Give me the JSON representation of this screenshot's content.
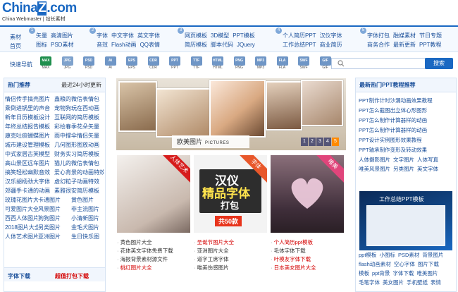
{
  "site": {
    "brand": "China",
    "brand_z": "Z",
    "brand_com": ".com",
    "sub_en": "China Webmaster",
    "sub_cn": "站长素材"
  },
  "nav": {
    "home_a": "素材",
    "home_b": "首页",
    "groups": [
      {
        "num": "1",
        "r1": [
          "矢量",
          "高清图片"
        ],
        "r2": [
          "图标",
          "PSD素材"
        ]
      },
      {
        "num": "2",
        "r1": [
          "字体",
          "中文字体",
          "英文字体"
        ],
        "r2": [
          "音效",
          "Flash动画",
          "QQ表情"
        ]
      },
      {
        "num": "3",
        "r1": [
          "网页模板",
          "3D模型",
          "PPT模板"
        ],
        "r2": [
          "简历模板",
          "脚本代码",
          "JQuery"
        ]
      },
      {
        "num": "4",
        "r1": [
          "个人简历PPT",
          "汉仪字体"
        ],
        "r2": [
          "工作总结PPT",
          "商业简历"
        ]
      },
      {
        "num": "5",
        "r1": [
          "字体打包",
          "融媒素材",
          "节日专题"
        ],
        "r2": [
          "商务合作",
          "最新更新",
          "PPT教程"
        ]
      }
    ]
  },
  "quick": {
    "label": "快速导航",
    "items": [
      {
        "name": "MAX",
        "color": "#1f8f4d"
      },
      {
        "name": "JPG",
        "color": "#7fa2cc"
      },
      {
        "name": "PSD",
        "color": "#6f96c6"
      },
      {
        "name": "Ai",
        "color": "#6f96c6"
      },
      {
        "name": "EPS",
        "color": "#6f96c6"
      },
      {
        "name": "CDR",
        "color": "#6f96c6"
      },
      {
        "name": "PPT",
        "color": "#6f96c6"
      },
      {
        "name": "TTF",
        "color": "#6f96c6"
      },
      {
        "name": "HTML",
        "color": "#6f96c6"
      },
      {
        "name": "PNG",
        "color": "#6f96c6"
      },
      {
        "name": "MP3",
        "color": "#6f96c6"
      },
      {
        "name": "FLA",
        "color": "#6f96c6"
      },
      {
        "name": "SWF",
        "color": "#6f96c6"
      },
      {
        "name": "GIF",
        "color": "#6f96c6"
      }
    ],
    "search_placeholder": "",
    "search_btn": "搜索"
  },
  "left": {
    "title": "热门推荐",
    "subtitle": "最近24小时更新",
    "rows": [
      [
        "情侣传手搞壳图片",
        "鑫粮的微信表情包"
      ],
      [
        "乘倒进锅里的声音",
        "宠物狗玩在西动画"
      ],
      [
        "新年日历模板设计",
        "互联网的简历模板"
      ],
      [
        "年终总结报告模板",
        "彩绘春季花朵矢量"
      ],
      [
        "康克吐痰蝴蝶图片",
        "雨中撑伞情侣矢量"
      ],
      [
        "城市建设管理模板",
        "几何图形图放动画"
      ],
      [
        "中式家居古芙模型",
        "财务实习简历模板"
      ],
      [
        "高山景区远车图片",
        "猫儿的微信表情包"
      ],
      [
        "搞笑轻松幽默音效",
        "爱心背景的动画特效"
      ],
      [
        "汉乐胡杨劲大字体",
        "虚幻粒子动画特效"
      ],
      [
        "郊疆手卡通的动画",
        "素雅很安简历模板"
      ],
      [
        "玫瑰花图片大全",
        "卡通图片",
        "黄色图片"
      ],
      [
        "可爱图片大全",
        "风景图片",
        "非主流图片"
      ],
      [
        "西西人体图片",
        "狗狗图片",
        "小清新图片"
      ],
      [
        "2018图片大全",
        "另类图片",
        "金毛犬图片"
      ],
      [
        "人体艺术图片",
        "亚洲图片",
        "生日快乐图"
      ]
    ],
    "foot_a": "字体下载",
    "foot_b": "超值打包下载"
  },
  "banner": {
    "caption": "欧美图片",
    "caption_en": "PICTURES",
    "pages": [
      "1",
      "2",
      "3",
      "4",
      "5"
    ]
  },
  "tiles": [
    {
      "corner": "人体艺术",
      "corner_color": "#d61c1c"
    },
    {
      "corner": "字体",
      "corner_color": "#e8572a",
      "t1": "汉仪",
      "t2": "精品字体",
      "t3": "打包",
      "t4": "共50款"
    },
    {
      "corner": "唯美",
      "corner_color": "#e0457b"
    }
  ],
  "clists": [
    {
      "items": [
        {
          "t": "黄色图片大全",
          "c": "#333"
        },
        {
          "t": "花体英文字体免费下载",
          "c": "#333"
        },
        {
          "t": "海报背景素材源文件",
          "c": "#333"
        },
        {
          "t": "桃红图片大全",
          "c": "#d40000"
        }
      ]
    },
    {
      "items": [
        {
          "t": "圣诞节图片大全",
          "c": "#d40000"
        },
        {
          "t": "亚洲图片大全",
          "c": "#333"
        },
        {
          "t": "道字工席字体",
          "c": "#333"
        },
        {
          "t": "唯美伤感图片",
          "c": "#333"
        }
      ]
    },
    {
      "items": [
        {
          "t": "个人简历ppt模板",
          "c": "#d40000"
        },
        {
          "t": "毛体字体下载",
          "c": "#333"
        },
        {
          "t": "叶模友字体下载",
          "c": "#d40000"
        },
        {
          "t": "日本美女图片大全",
          "c": "#d40000"
        }
      ]
    }
  ],
  "right": {
    "title": "最新热门PPT教程推荐",
    "list": [
      "PPT制作计时沙漏动画效果教程",
      "PPT怎么截图出立体心形图形",
      "PPT怎么制作计算器样的动画",
      "PPT怎么制作计算器样的动画",
      "PPT设计实例图形效果教程",
      "PPT轴承制作变形及转动效果"
    ],
    "rows1": [
      [
        "人体摄影图片",
        "文字图片",
        "人体写真"
      ],
      [
        "唯美风景图片",
        "另类图片",
        "英文字体"
      ]
    ],
    "ppt_title": "工作总结PPT模板",
    "rows2": [
      [
        "ppt模板",
        "小图标",
        "PSD素材",
        "背景图片"
      ],
      [
        "flash动画素材",
        "空心字体",
        "图片下载"
      ],
      [
        "模板",
        "ppt背景",
        "字体下载",
        "唯美图片"
      ],
      [
        "毛笔字体",
        "美女图片",
        "手机壁纸",
        "表情"
      ]
    ]
  }
}
